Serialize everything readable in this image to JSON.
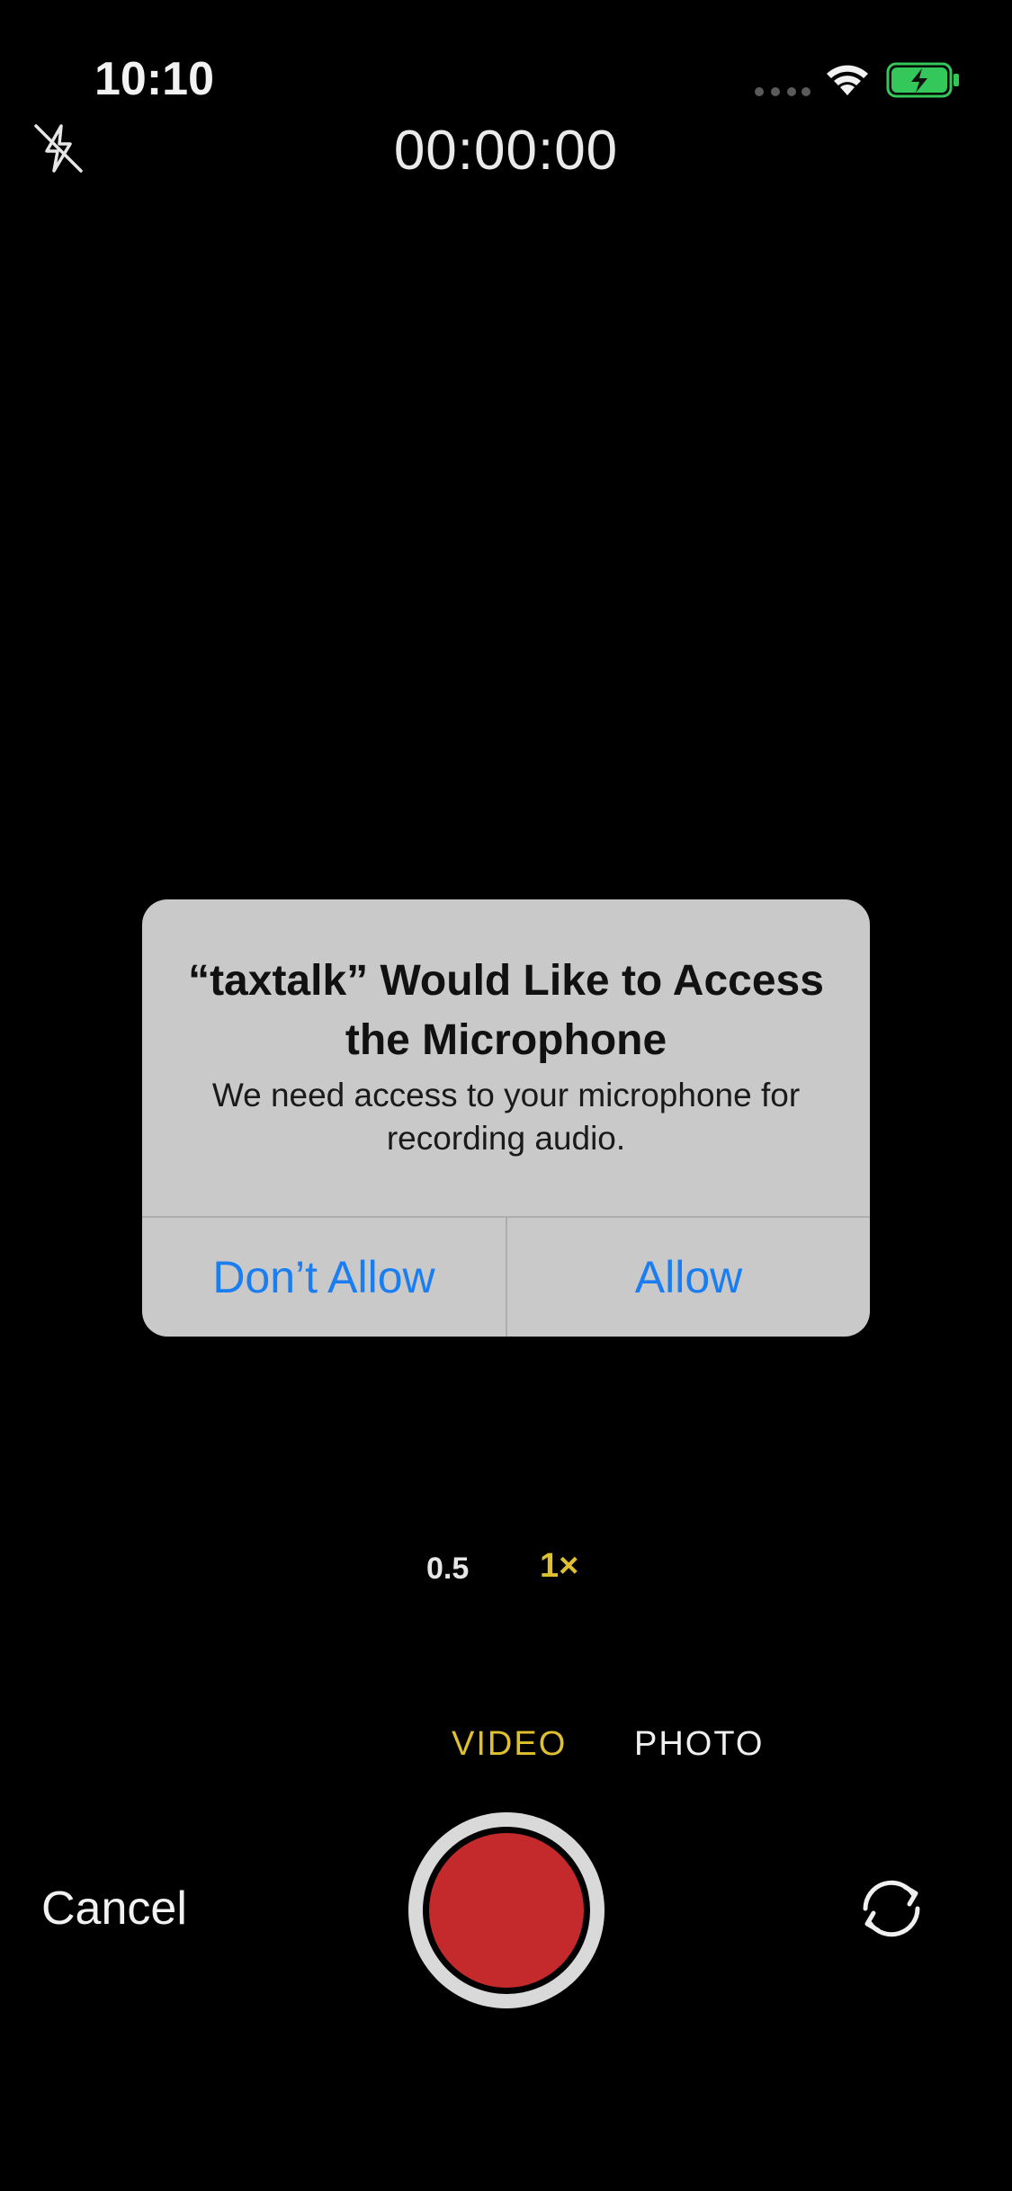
{
  "status_bar": {
    "time": "10:10",
    "battery_color": "#34c759"
  },
  "top_bar": {
    "flash_icon": "flash-off-icon",
    "timer": "00:00:00"
  },
  "alert": {
    "title": "“taxtalk” Would Like to Access the Microphone",
    "message": "We need access to your microphone for recording audio.",
    "deny_label": "Don’t Allow",
    "allow_label": "Allow",
    "button_color": "#1a7ef2"
  },
  "zoom": {
    "options": [
      "0.5",
      "1×"
    ],
    "selected": "1×"
  },
  "modes": {
    "items": [
      "VIDEO",
      "PHOTO"
    ],
    "selected": "VIDEO",
    "accent_color": "#e0c02f"
  },
  "bottom_bar": {
    "cancel_label": "Cancel",
    "record_color": "#c4292b",
    "flip_icon": "camera-flip-icon"
  }
}
